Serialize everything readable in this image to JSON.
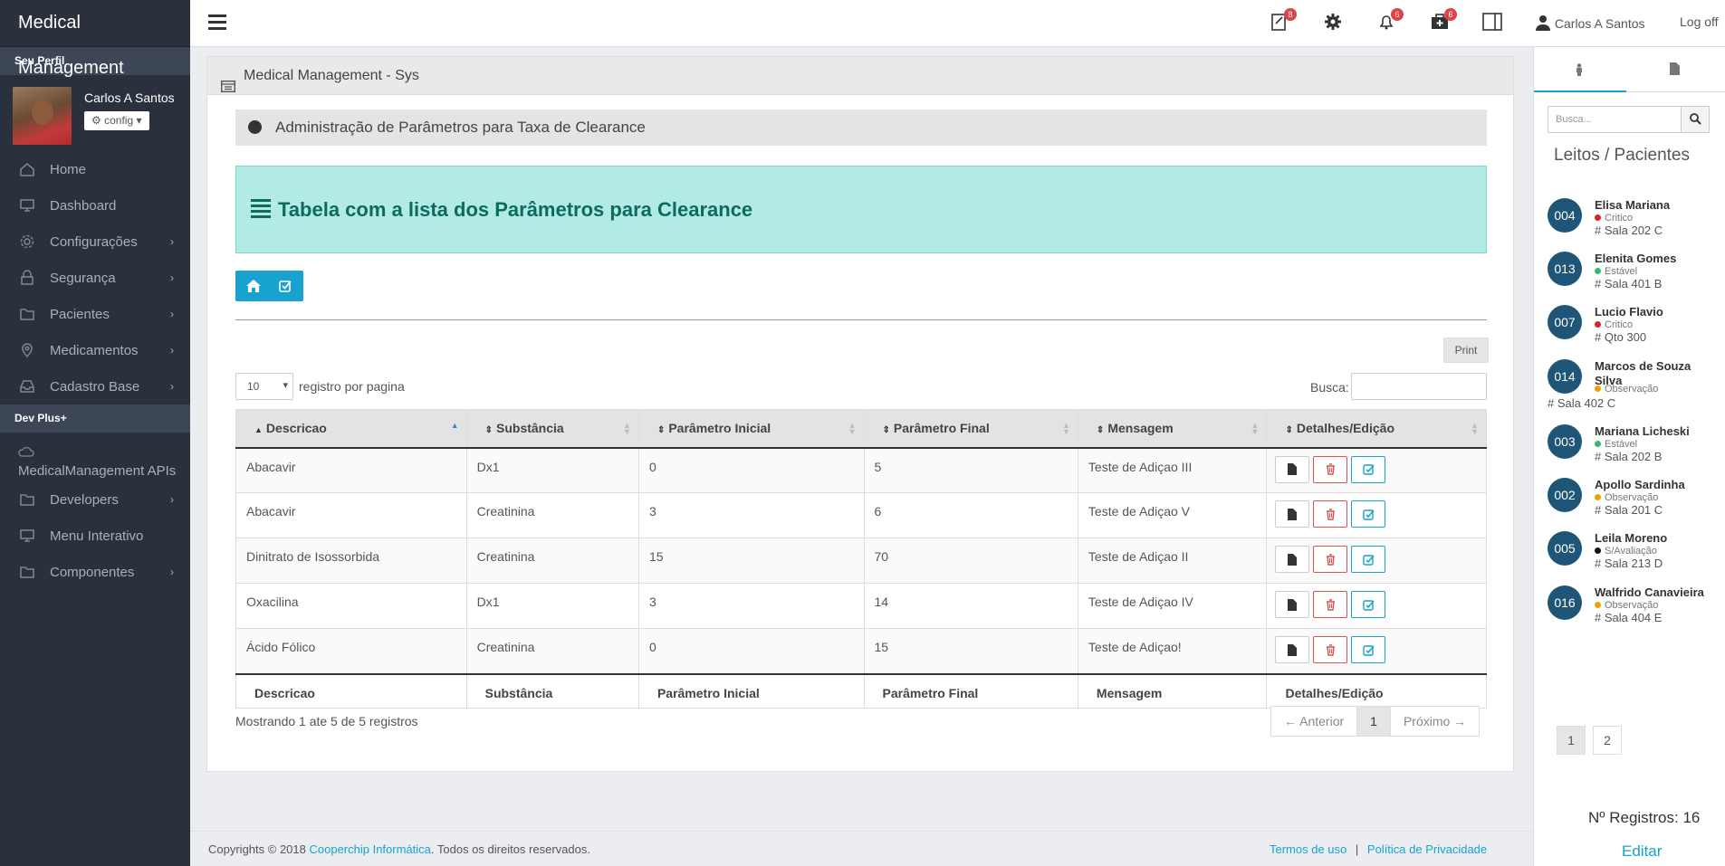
{
  "brand": "Medical Management",
  "sidebar": {
    "profile_header": "Seu Perfil",
    "user_name": "Carlos A Santos",
    "config_label": "config ▾",
    "items": [
      {
        "label": "Home",
        "icon": "home-icon",
        "chev": false
      },
      {
        "label": "Dashboard",
        "icon": "monitor-icon",
        "chev": false
      },
      {
        "label": "Configurações",
        "icon": "gear-icon",
        "chev": true
      },
      {
        "label": "Segurança",
        "icon": "lock-icon",
        "chev": true
      },
      {
        "label": "Pacientes",
        "icon": "folder-icon",
        "chev": true
      },
      {
        "label": "Medicamentos",
        "icon": "pin-icon",
        "chev": true
      },
      {
        "label": "Cadastro Base",
        "icon": "inbox-icon",
        "chev": true
      }
    ],
    "dev_header": "Dev Plus+",
    "api_label": "MedicalManagement APIs",
    "dev_items": [
      {
        "label": "Developers",
        "icon": "folder-icon",
        "chev": true
      },
      {
        "label": "Menu Interativo",
        "icon": "monitor-icon",
        "chev": false
      },
      {
        "label": "Componentes",
        "icon": "folder-icon",
        "chev": true
      }
    ]
  },
  "topbar": {
    "badges": {
      "tasks": "8",
      "notifications": "6",
      "hospital": "6"
    },
    "user": "Carlos A Santos",
    "logoff": "Log off"
  },
  "panel": {
    "title": "Medical Management - Sys",
    "subtitle": "Administração de Parâmetros para Taxa de Clearance",
    "alert": "Tabela com a lista dos Parâmetros para Clearance",
    "print": "Print",
    "length_value": "10",
    "length_label": "registro por pagina",
    "search_label": "Busca:",
    "info": "Mostrando 1 ate 5 de 5 registros",
    "pager": {
      "prev": "← Anterior",
      "current": "1",
      "next": "Próximo →"
    }
  },
  "table": {
    "headers": [
      "Descricao",
      "Substância",
      "Parâmetro Inicial",
      "Parâmetro Final",
      "Mensagem",
      "Detalhes/Edição"
    ],
    "rows": [
      [
        "Abacavir",
        "Dx1",
        "0",
        "5",
        "Teste de Adiçao III"
      ],
      [
        "Abacavir",
        "Creatinina",
        "3",
        "6",
        "Teste de Adiçao V"
      ],
      [
        "Dinitrato de Isossorbida",
        "Creatinina",
        "15",
        "70",
        "Teste de Adiçao II"
      ],
      [
        "Oxacilina",
        "Dx1",
        "3",
        "14",
        "Teste de Adiçao IV"
      ],
      [
        "Ácido Fólico",
        "Creatinina",
        "0",
        "15",
        "Teste de Adiçao!"
      ]
    ]
  },
  "footer": {
    "copy_prefix": "Copyrights © 2018",
    "company": "Cooperchip Informática",
    "copy_suffix": ". Todos os direitos reservados.",
    "terms": "Termos de uso",
    "sep": "|",
    "privacy": "Política de Privacidade"
  },
  "right_panel": {
    "search_placeholder": "Busca...",
    "title": "Leitos / Pacientes",
    "patients": [
      {
        "num": "004",
        "name": "Elisa Mariana",
        "status": "Critico",
        "color": "#e02020",
        "room": "# Sala 202 C"
      },
      {
        "num": "013",
        "name": "Elenita Gomes",
        "status": "Estável",
        "color": "#3cb371",
        "room": "# Sala 401 B"
      },
      {
        "num": "007",
        "name": "Lucio Flavio",
        "status": "Critico",
        "color": "#e02020",
        "room": "# Qto 300"
      },
      {
        "num": "014",
        "name": "Marcos de Souza Silva",
        "status": "Observação",
        "color": "#f0a000",
        "room": "# Sala 402 C"
      },
      {
        "num": "003",
        "name": "Mariana Licheski",
        "status": "Estável",
        "color": "#3cb371",
        "room": "# Sala 202 B"
      },
      {
        "num": "002",
        "name": "Apollo Sardinha",
        "status": "Observação",
        "color": "#f0a000",
        "room": "# Sala 201 C"
      },
      {
        "num": "005",
        "name": "Leila Moreno",
        "status": "S/Avaliação",
        "color": "#111111",
        "room": "# Sala 213 D"
      },
      {
        "num": "016",
        "name": "Walfrido Canavieira",
        "status": "Observação",
        "color": "#f0a000",
        "room": "# Sala 404 E"
      }
    ],
    "pages": [
      "1",
      "2"
    ],
    "count": "Nº Registros: 16",
    "edit": "Editar"
  }
}
